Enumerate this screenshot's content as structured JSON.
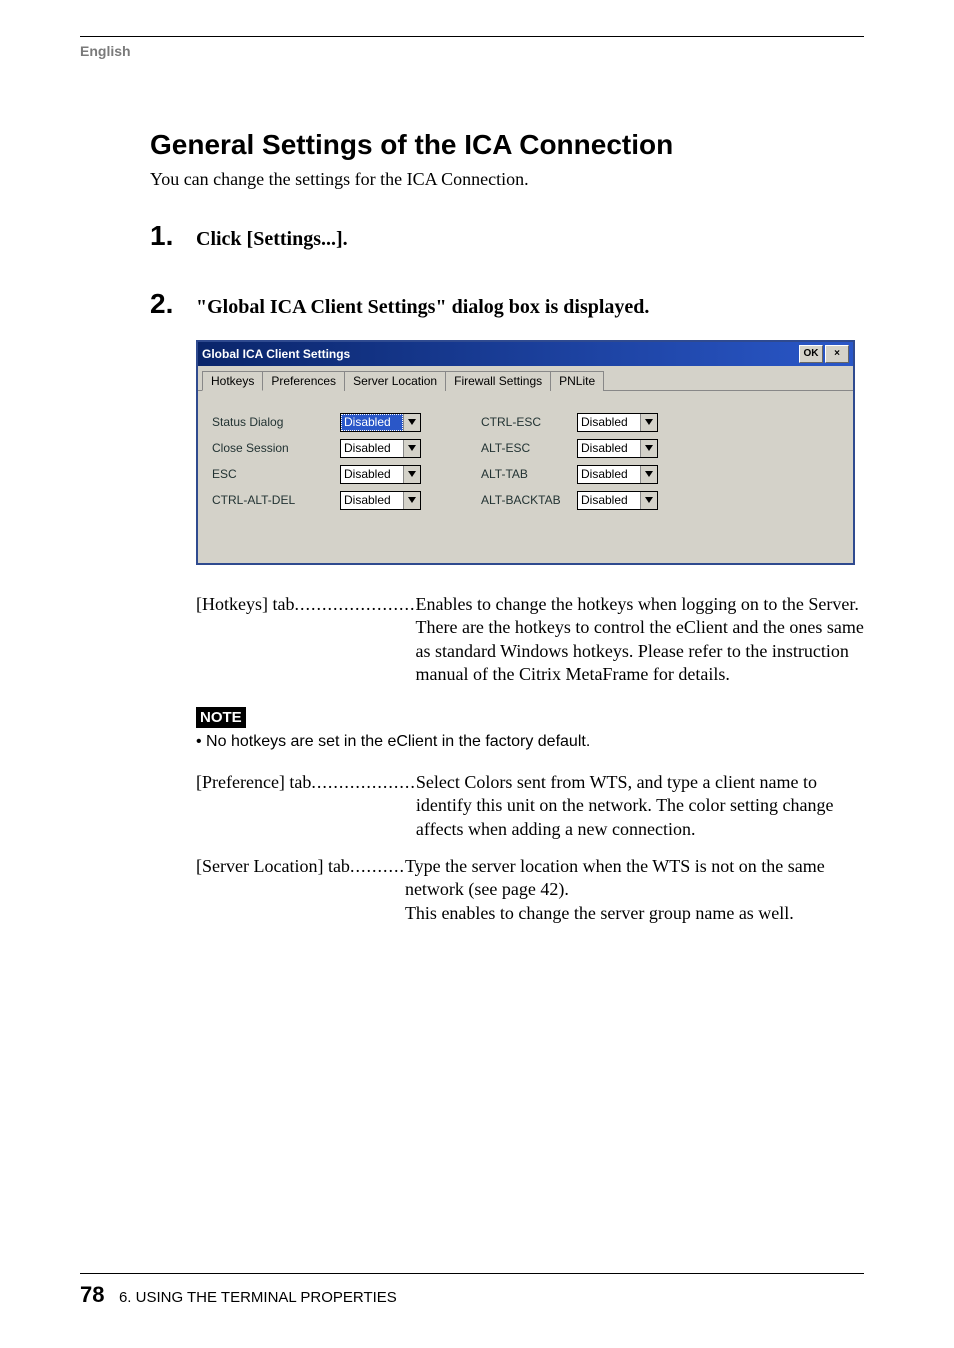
{
  "header": {
    "language": "English"
  },
  "title": "General Settings of the ICA Connection",
  "intro": "You can change the settings for the ICA Connection.",
  "steps": [
    {
      "num": "1.",
      "text": "Click [Settings...]."
    },
    {
      "num": "2.",
      "text": "\"Global ICA Client Settings\" dialog box is displayed."
    }
  ],
  "dialog": {
    "title": "Global ICA Client Settings",
    "ok": "OK",
    "close": "×",
    "tabs": [
      "Hotkeys",
      "Preferences",
      "Server Location",
      "Firewall Settings",
      "PNLite"
    ],
    "rows": [
      {
        "l": "Status Dialog",
        "lv": "Disabled",
        "r": "CTRL-ESC",
        "rv": "Disabled",
        "sel": true
      },
      {
        "l": "Close Session",
        "lv": "Disabled",
        "r": "ALT-ESC",
        "rv": "Disabled",
        "sel": false
      },
      {
        "l": "ESC",
        "lv": "Disabled",
        "r": "ALT-TAB",
        "rv": "Disabled",
        "sel": false
      },
      {
        "l": "CTRL-ALT-DEL",
        "lv": "Disabled",
        "r": "ALT-BACKTAB",
        "rv": "Disabled",
        "sel": false
      }
    ]
  },
  "definitions": {
    "hotkeys_term": "[Hotkeys] tab",
    "hotkeys_dots": "......................",
    "hotkeys_def": "Enables to change the hotkeys when logging on to the Server.  There are the hotkeys to control the eClient and the ones same as standard Windows hotkeys.  Please refer to the instruction manual of the Citrix MetaFrame for details.",
    "pref_term": "[Preference] tab",
    "pref_dots": "...................",
    "pref_def": "Select Colors sent from WTS, and type a client name to identify this unit on the network.  The color setting change affects when adding a new connection.",
    "serv_term": "[Server Location] tab ",
    "serv_dots": "..........",
    "serv_def1": "Type the server location when the WTS is not on the same network (see page 42).",
    "serv_def2": "This enables to change the server group name as well."
  },
  "note": {
    "label": "NOTE",
    "bullet": "•  No hotkeys are set in the eClient in the factory default."
  },
  "footer": {
    "page": "78",
    "chapter": "6. USING THE TERMINAL PROPERTIES"
  }
}
